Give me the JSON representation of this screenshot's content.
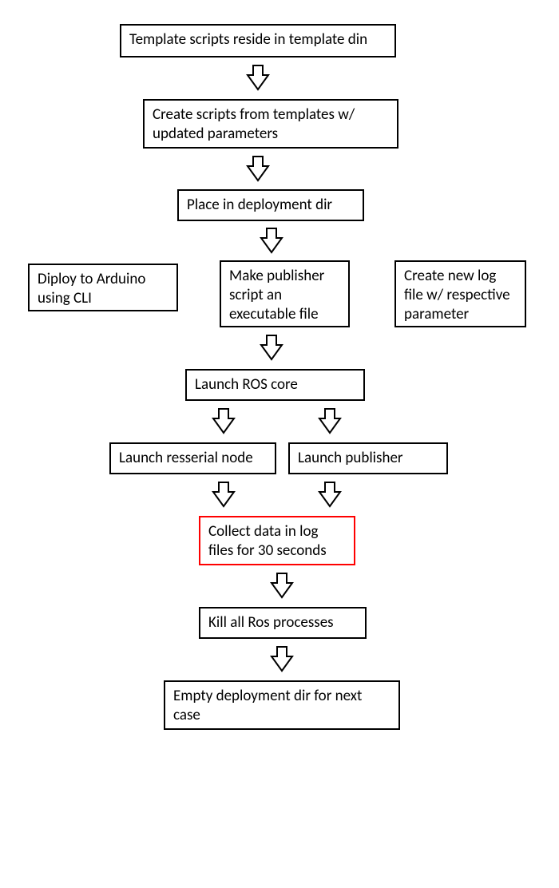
{
  "boxes": {
    "b1": "Template scripts reside in template din",
    "b2": "Create scripts from templates w/ updated parameters",
    "b3": "Place in deployment dir",
    "b4left": "Diploy to Arduino using CLI",
    "b4mid": "Make publisher script an executable file",
    "b4right": "Create new log file w/ respective parameter",
    "b5": "Launch ROS core",
    "b6left": "Launch resserial node",
    "b6right": "Launch publisher",
    "b7": "Collect data in log files for 30 seconds",
    "b8": "Kill all Ros processes",
    "b9": "Empty deployment dir for next case"
  }
}
